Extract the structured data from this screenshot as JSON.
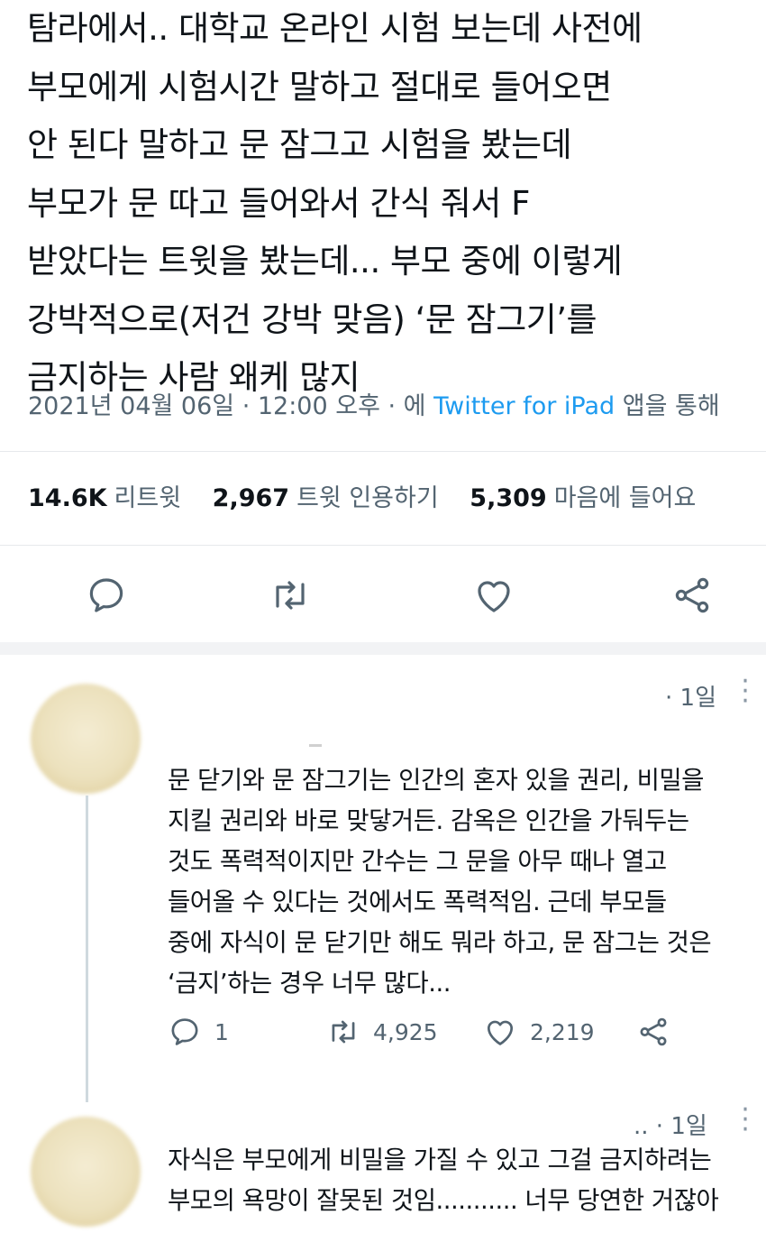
{
  "tweet": {
    "text": "탐라에서.. 대학교 온라인 시험 보는데 사전에\n부모에게 시험시간 말하고 절대로 들어오면\n안 된다 말하고 문 잠그고 시험을 봤는데\n부모가 문 따고 들어와서 간식 줘서 F\n받았다는 트윗을 봤는데... 부모 중에 이렇게\n강박적으로(저건 강박 맞음) ‘문 잠그기’를\n금지하는 사람 왜케 많지",
    "meta_date": "2021년 04월 06일 · 12:00 오후 · 에 ",
    "meta_via": "Twitter for iPad",
    "meta_suffix": " 앱을 통해",
    "retweets_count": "14.6K",
    "retweets_label": "리트윗",
    "quotes_count": "2,967",
    "quotes_label": "트윗 인용하기",
    "likes_count": "5,309",
    "likes_label": "마음에 들어요"
  },
  "replies": [
    {
      "time": "· 1일",
      "text": "문 닫기와 문 잠그기는 인간의 혼자 있을 권리, 비밀을\n지킬 권리와 바로 맞닿거든. 감옥은 인간을 가둬두는\n것도 폭력적이지만 간수는 그 문을 아무 때나 열고\n들어올 수 있다는 것에서도 폭력적임. 근데 부모들\n중에 자식이 문 닫기만 해도 뭐라 하고, 문 잠그는 것은\n‘금지’하는 경우 너무 많다...",
      "reply_count": "1",
      "retweet_count": "4,925",
      "like_count": "2,219"
    },
    {
      "time": ".. · 1일",
      "text": "자식은 부모에게 비밀을 가질 수 있고 그걸 금지하려는\n부모의 욕망이 잘못된 것임........... 너무 당연한 거잖아"
    }
  ],
  "icons": {
    "reply": "speech-bubble-icon",
    "retweet": "retweet-arrows-icon",
    "like": "heart-icon",
    "share": "share-nodes-icon",
    "more": "vertical-dots-icon"
  },
  "colors": {
    "link": "#1d9bf0",
    "muted": "#536471",
    "text": "#0f1419"
  }
}
